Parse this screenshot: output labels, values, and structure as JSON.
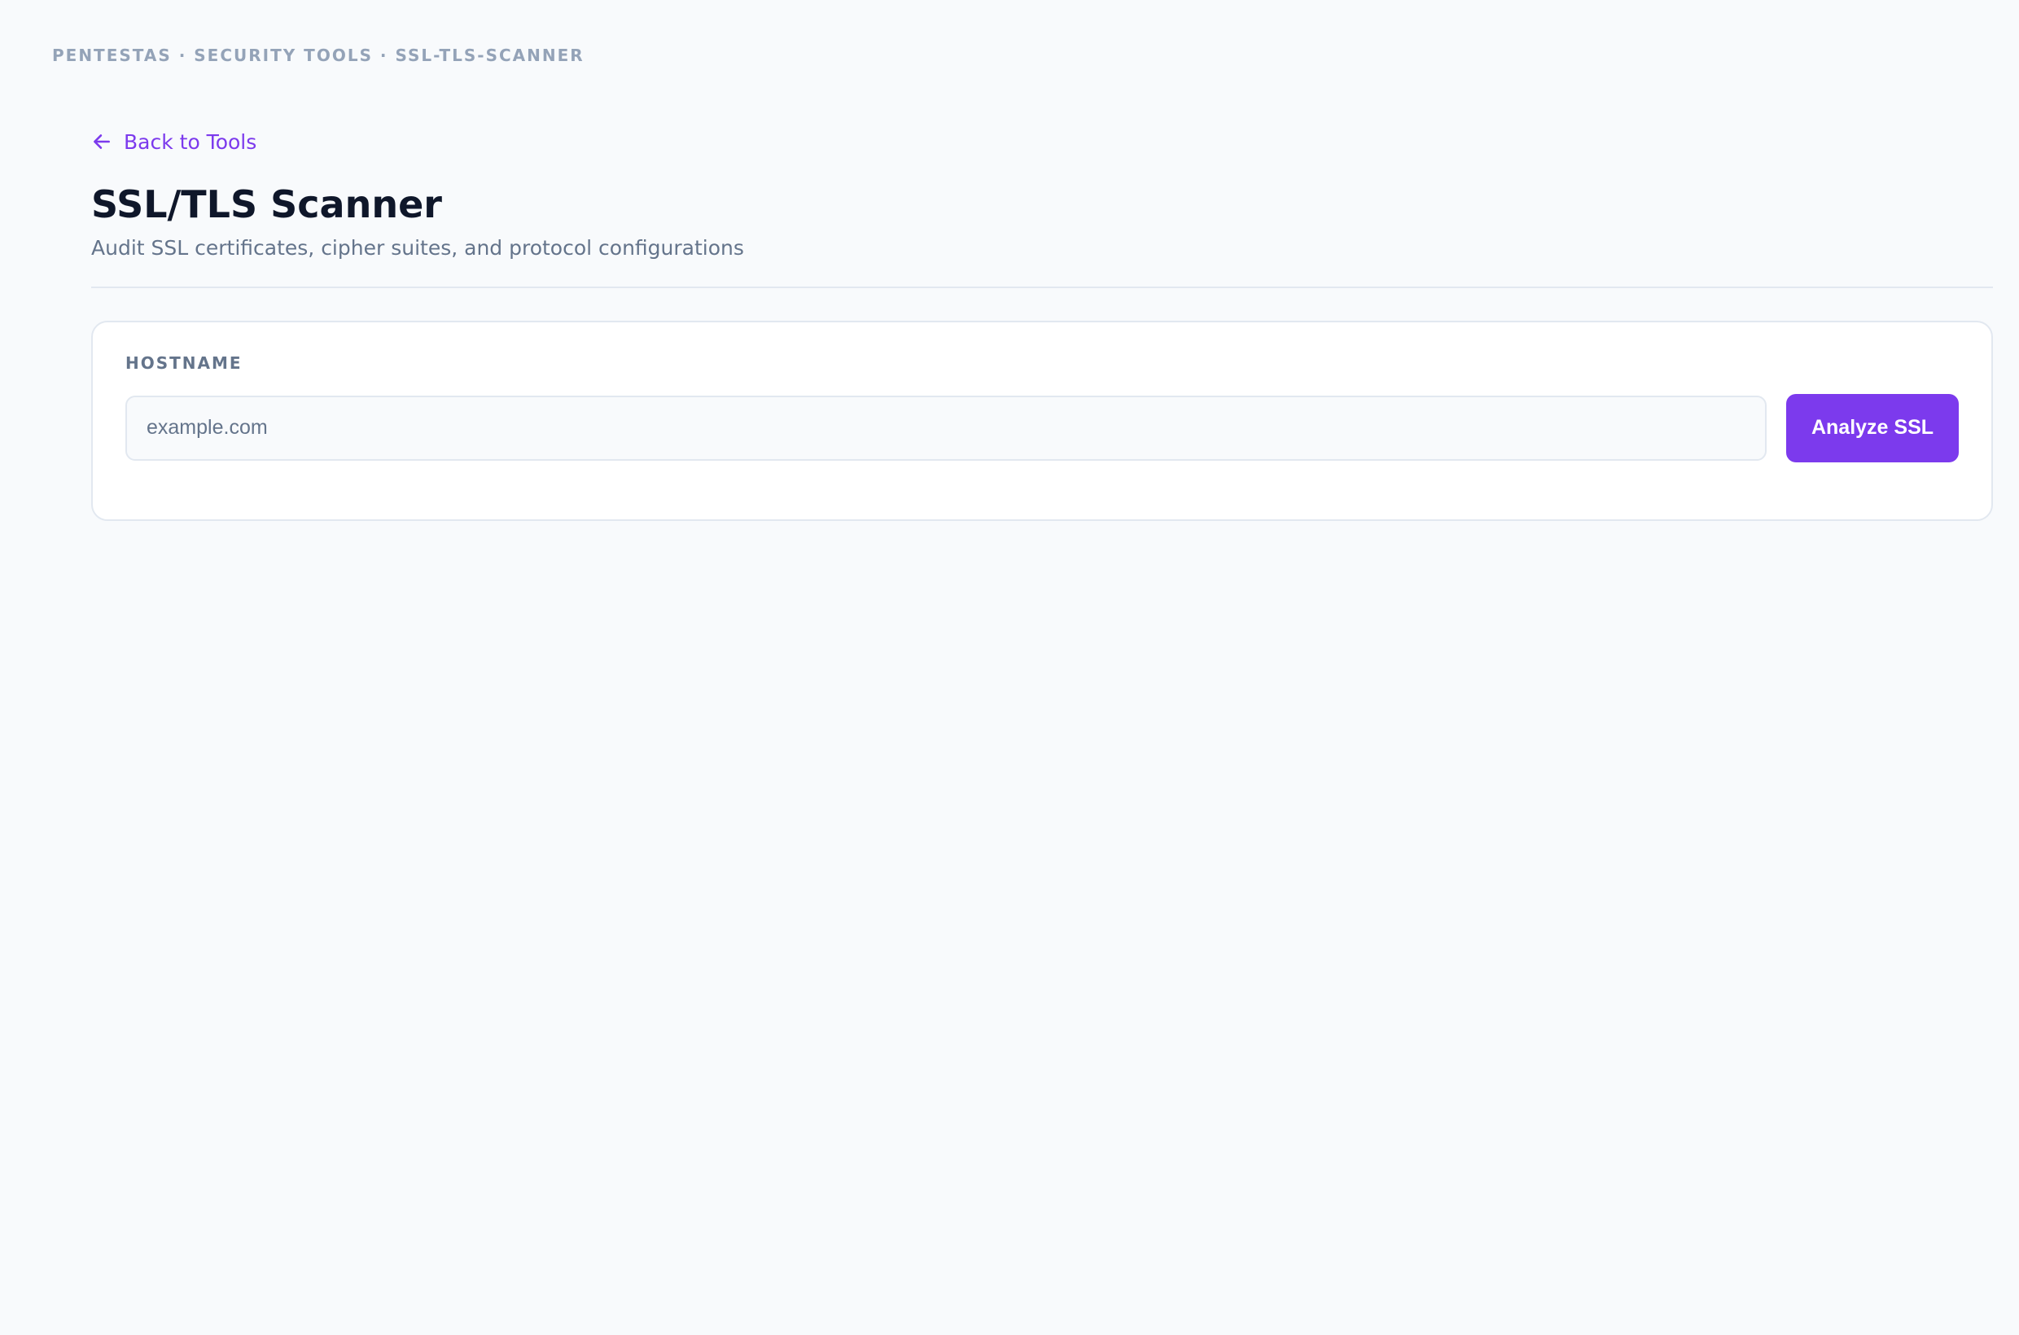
{
  "breadcrumb": {
    "text": "PENTESTAS · SECURITY TOOLS · SSL-TLS-SCANNER"
  },
  "nav": {
    "back_label": "Back to Tools",
    "back_icon": "arrow-left-icon"
  },
  "header": {
    "title": "SSL/TLS Scanner",
    "subtitle": "Audit SSL certificates, cipher suites, and protocol configurations"
  },
  "form": {
    "hostname_label": "HOSTNAME",
    "hostname_placeholder": "example.com",
    "hostname_value": "",
    "submit_label": "Analyze SSL"
  },
  "colors": {
    "accent": "#7c3aed",
    "background": "#f8fafc",
    "card": "#ffffff",
    "border": "#e2e8f0",
    "muted_text": "#64748b",
    "breadcrumb_text": "#94a3b8",
    "title_text": "#0f172a"
  }
}
